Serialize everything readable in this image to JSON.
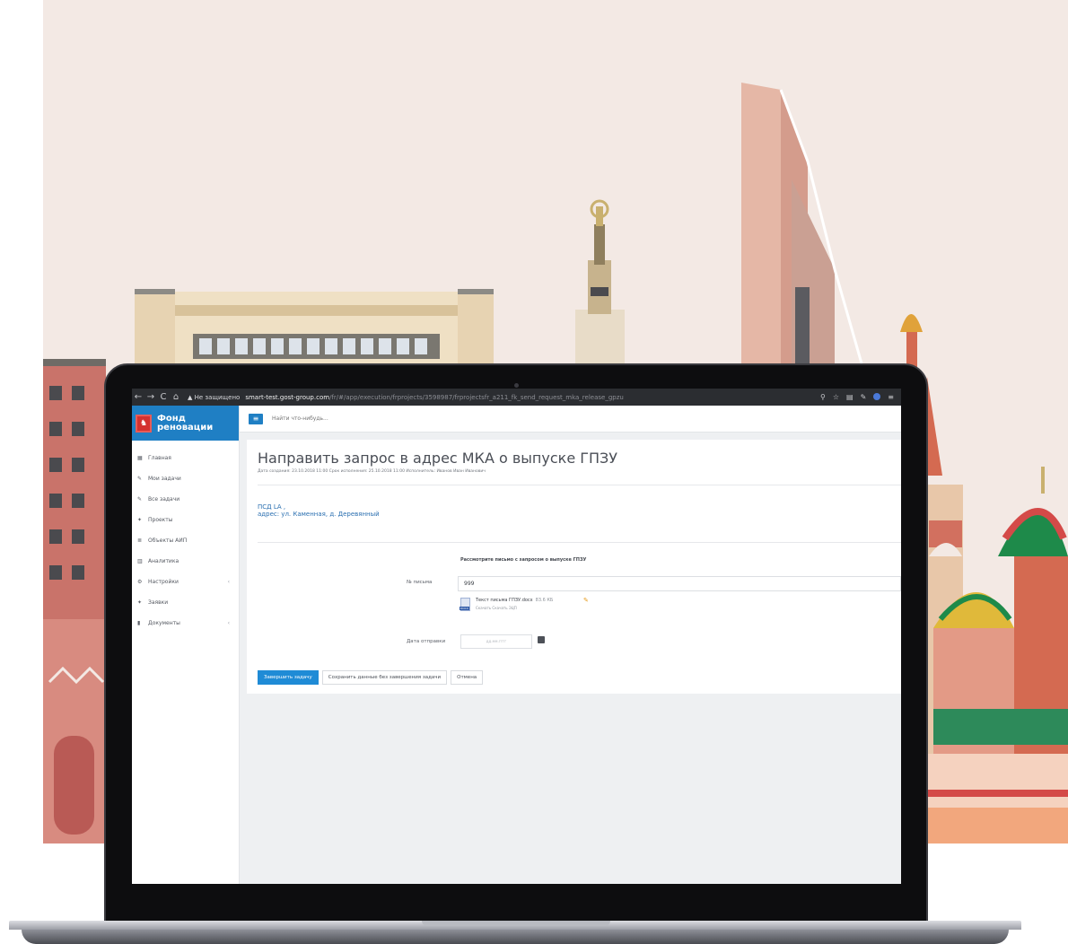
{
  "browser": {
    "nav_back": "←",
    "nav_forward": "→",
    "nav_reload": "C",
    "nav_home": "⌂",
    "security_label": "▲ Не защищено",
    "url_host": "smart-test.gost-group.com",
    "url_path": "/fr/#/app/execution/frprojects/3598987/frprojectsfr_a211_fk_send_request_mka_release_gpzu"
  },
  "app": {
    "brand": {
      "line1": "Фонд",
      "line2": "реновации"
    },
    "search": {
      "placeholder": "Найти что-нибудь..."
    },
    "sidebar": {
      "items": [
        {
          "icon": "▦",
          "label": "Главная",
          "chevron": ""
        },
        {
          "icon": "✎",
          "label": "Мои задачи",
          "chevron": ""
        },
        {
          "icon": "✎",
          "label": "Все задачи",
          "chevron": ""
        },
        {
          "icon": "✦",
          "label": "Проекты",
          "chevron": ""
        },
        {
          "icon": "≣",
          "label": "Объекты АИП",
          "chevron": ""
        },
        {
          "icon": "▥",
          "label": "Аналитика",
          "chevron": ""
        },
        {
          "icon": "⚙",
          "label": "Настройки",
          "chevron": "‹"
        },
        {
          "icon": "✦",
          "label": "Заявки",
          "chevron": ""
        },
        {
          "icon": "▮",
          "label": "Документы",
          "chevron": "‹"
        }
      ]
    },
    "task": {
      "title": "Направить запрос в адрес МКА о выпуске ГПЗУ",
      "meta": "Дата создания: 23.10.2018 11:00   Срок исполнения: 25.10.2018 11:00   Исполнитель: Иванов Иван Иванович",
      "address_line1": "ПСД LA ,",
      "address_line2": "адрес: ул. Каменная, д. Деревянный"
    },
    "form": {
      "title": "Рассмотрите письмо с запросом о выпуске ГПЗУ",
      "letter_number_label": "№ письма",
      "letter_number_value": "999",
      "file_name": "Текст письма ГПЗУ.docx",
      "file_size": "83.6 КБ",
      "file_badge": "DOCX",
      "file_links": "Скачать   Скачать ЭЦП",
      "send_date_label": "Дата отправки",
      "send_date_placeholder": "дд.мм.гггг"
    },
    "actions": {
      "complete": "Завершить задачу",
      "save_draft": "Сохранить данные без завершения задачи",
      "cancel": "Отмена"
    }
  },
  "colors": {
    "background": "#f3e9e4",
    "brand_blue": "#1f7fc4",
    "primary_button": "#1f8bd6",
    "link_blue": "#2a6fb0"
  }
}
